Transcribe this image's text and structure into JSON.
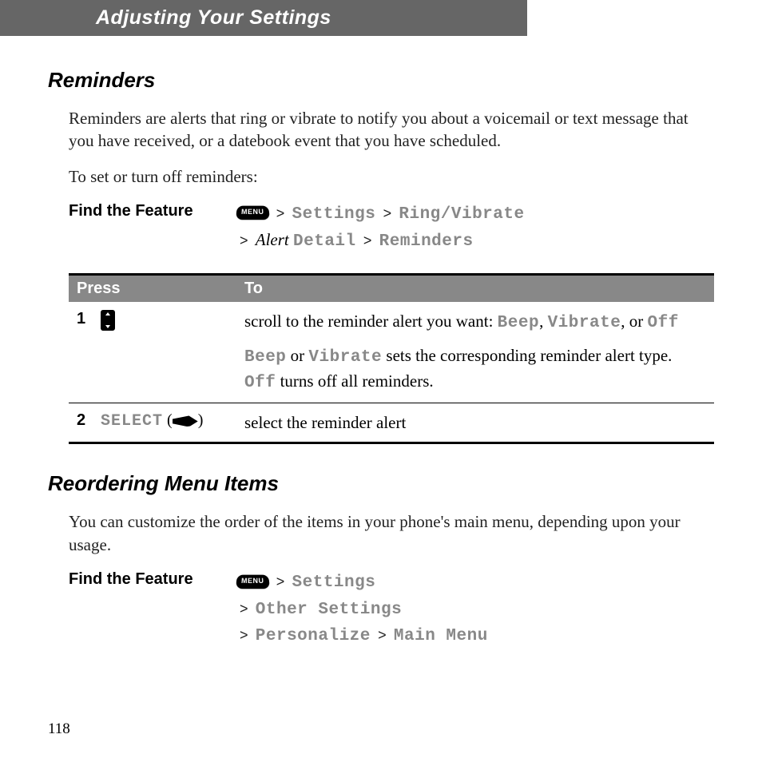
{
  "header": {
    "title": "Adjusting Your Settings"
  },
  "section1": {
    "heading": "Reminders",
    "p1": "Reminders are alerts that ring or vibrate to notify you about a voicemail or text message that you have received, or a datebook event that you have scheduled.",
    "p2": "To set or turn off reminders:",
    "find_label": "Find the Feature",
    "menu_key": "MENU",
    "path": {
      "settings": "Settings",
      "ring_vibrate": "Ring/Vibrate",
      "alert": "Alert",
      "detail": "Detail",
      "reminders": "Reminders",
      "gt": ">"
    },
    "table": {
      "press": "Press",
      "to": "To",
      "row1": {
        "num": "1",
        "desc_pre": "scroll to the reminder alert you want: ",
        "beep": "Beep",
        "vibrate": "Vibrate",
        "or": ", or ",
        "off": "Off",
        "para2_pre": "",
        "para2_mid": " or ",
        "para2_post": " sets the corresponding reminder alert type. ",
        "para2_end": " turns off all reminders."
      },
      "row2": {
        "num": "2",
        "select": "SELECT",
        "paren_open": " (",
        "paren_close": ")",
        "desc": "select the reminder alert"
      }
    }
  },
  "section2": {
    "heading": "Reordering Menu Items",
    "p1": "You can customize the order of the items in your phone's main menu, depending upon your usage.",
    "find_label": "Find the Feature",
    "menu_key": "MENU",
    "path": {
      "settings": "Settings",
      "other": "Other Settings",
      "personalize": "Personalize",
      "main_menu": "Main Menu",
      "gt": ">"
    }
  },
  "page_number": "118",
  "sep_comma": ", "
}
